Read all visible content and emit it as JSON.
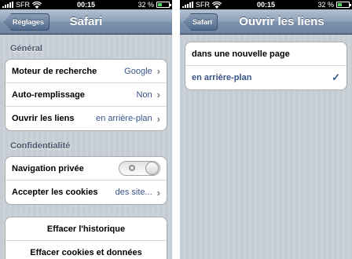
{
  "status_bar": {
    "carrier": "SFR",
    "time": "00:15",
    "battery": "32 %",
    "battery_level": 0.32
  },
  "left": {
    "nav": {
      "back_label": "Réglages",
      "title": "Safari"
    },
    "general_header": "Général",
    "general_rows": [
      {
        "label": "Moteur de recherche",
        "value": "Google"
      },
      {
        "label": "Auto-remplissage",
        "value": "Non"
      },
      {
        "label": "Ouvrir les liens",
        "value": "en arrière-plan"
      }
    ],
    "privacy_header": "Confidentialité",
    "privacy_rows": [
      {
        "label": "Navigation privée",
        "toggle_on": false
      },
      {
        "label": "Accepter les cookies",
        "value": "des site..."
      }
    ],
    "actions": [
      {
        "label": "Effacer l'historique"
      },
      {
        "label": "Effacer cookies et données"
      }
    ]
  },
  "right": {
    "nav": {
      "back_label": "Safari",
      "title": "Ouvrir les liens"
    },
    "options": [
      {
        "label": "dans une nouvelle page",
        "selected": false
      },
      {
        "label": "en arrière-plan",
        "selected": true
      }
    ]
  },
  "icons": {
    "chevron": "chevron-right-icon",
    "check": "checkmark-icon",
    "wifi": "wifi-icon",
    "battery": "battery-icon"
  },
  "colors": {
    "value_blue": "#385487",
    "nav_bar": "#7d92ad",
    "background": "#c5ccd4",
    "battery_fill": "#4cd964"
  }
}
